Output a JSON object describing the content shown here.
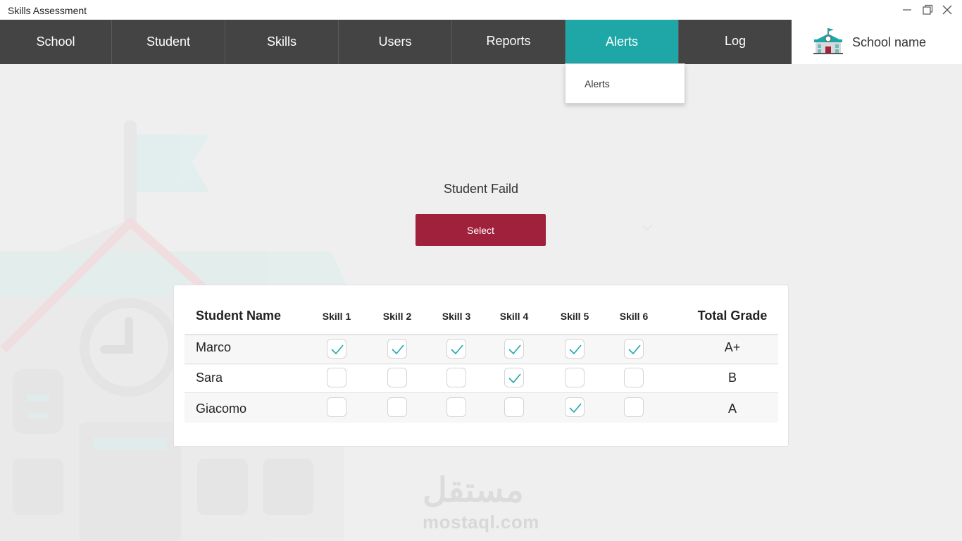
{
  "window": {
    "title": "Skills Assessment"
  },
  "nav": {
    "items": [
      {
        "label": "School"
      },
      {
        "label": "Student"
      },
      {
        "label": "Skills"
      },
      {
        "label": "Users"
      },
      {
        "label": "Reports"
      },
      {
        "label": "Alerts",
        "active": true
      },
      {
        "label": "Log"
      }
    ],
    "school_name": "School name"
  },
  "dropdown": {
    "items": [
      {
        "label": "Alerts"
      }
    ]
  },
  "filter": {
    "label": "Student Faild",
    "button_label": "Select"
  },
  "table": {
    "columns": [
      "Student Name",
      "Skill 1",
      "Skill 2",
      "Skill 3",
      "Skill 4",
      "Skill 5",
      "Skill 6",
      "Total Grade"
    ],
    "rows": [
      {
        "name": "Marco",
        "skills": [
          true,
          true,
          true,
          true,
          true,
          true
        ],
        "grade": "A+"
      },
      {
        "name": "Sara",
        "skills": [
          false,
          false,
          false,
          true,
          false,
          false
        ],
        "grade": "B"
      },
      {
        "name": "Giacomo",
        "skills": [
          false,
          false,
          false,
          false,
          true,
          false
        ],
        "grade": "A"
      }
    ]
  },
  "watermark": {
    "arabic": "مستقل",
    "latin": "mostaql.com"
  },
  "colors": {
    "nav_bg": "#444444",
    "nav_active": "#1fa7a8",
    "select_button": "#a0213b",
    "check": "#1fa7a8"
  }
}
